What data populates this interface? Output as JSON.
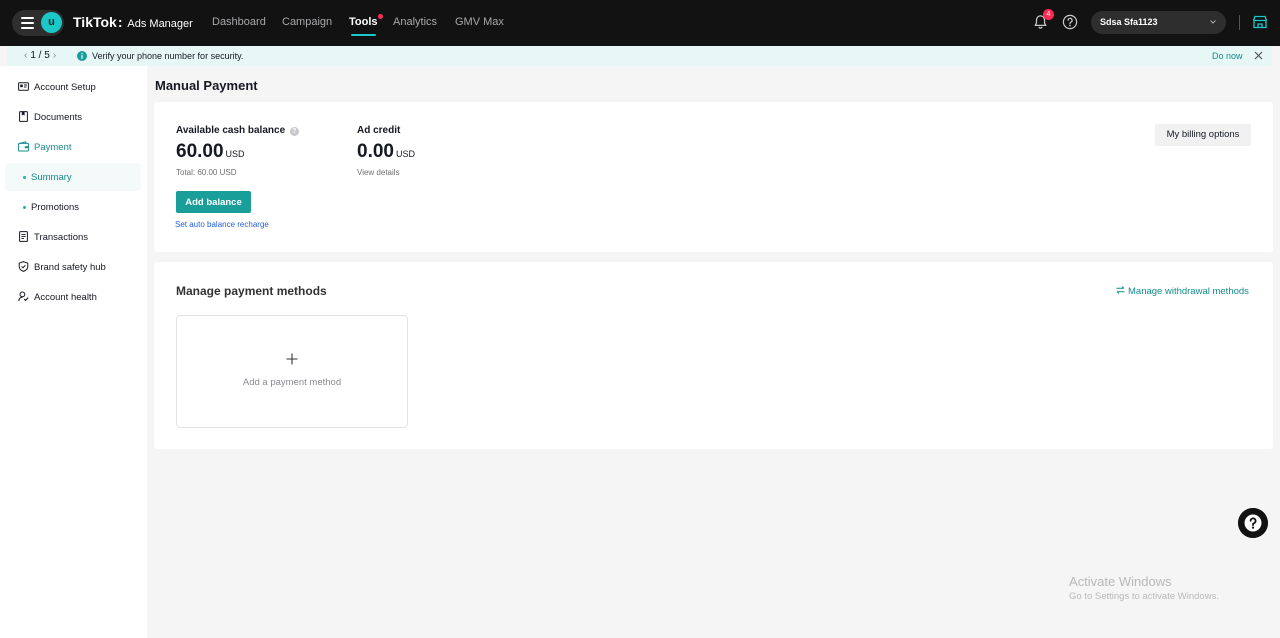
{
  "header": {
    "logo_letter": "u",
    "brand": "TikTok",
    "brand_separator": ":",
    "product": "Ads Manager",
    "nav": [
      {
        "label": "Dashboard"
      },
      {
        "label": "Campaign"
      },
      {
        "label": "Tools"
      },
      {
        "label": "Analytics"
      },
      {
        "label": "GMV Max"
      }
    ],
    "notification_count": "4",
    "account_name": "Sdsa Sfa1123"
  },
  "notice": {
    "pager": "1 / 5",
    "message": "Verify your phone number for security.",
    "action": "Do now"
  },
  "sidebar": {
    "items": [
      {
        "label": "Account Setup"
      },
      {
        "label": "Documents"
      },
      {
        "label": "Payment"
      },
      {
        "label": "Summary"
      },
      {
        "label": "Promotions"
      },
      {
        "label": "Transactions"
      },
      {
        "label": "Brand safety hub"
      },
      {
        "label": "Account health"
      }
    ]
  },
  "main": {
    "title": "Manual Payment",
    "balance": {
      "label": "Available cash balance",
      "amount": "60.00",
      "currency": "USD",
      "total": "Total: 60.00 USD",
      "add_button": "Add balance",
      "auto_link": "Set auto balance recharge"
    },
    "credit": {
      "label": "Ad credit",
      "amount": "0.00",
      "currency": "USD",
      "details": "View details"
    },
    "billing_button": "My billing options",
    "payment_methods": {
      "title": "Manage payment methods",
      "withdraw_link": "Manage withdrawal methods",
      "add_label": "Add a payment method"
    }
  },
  "watermark": {
    "line1": "Activate Windows",
    "line2": "Go to Settings to activate Windows."
  },
  "colors": {
    "accent": "#1a9e99",
    "topbar": "#121212",
    "notification": "#fe2c55"
  }
}
